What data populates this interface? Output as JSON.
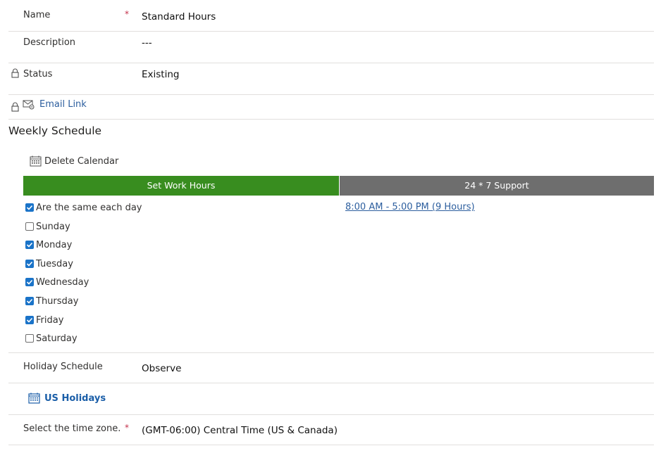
{
  "fields": {
    "name": {
      "label": "Name",
      "required_mark": "*",
      "value": "Standard Hours"
    },
    "description": {
      "label": "Description",
      "value": "---"
    },
    "status": {
      "label": "Status",
      "value": "Existing"
    },
    "email_link": {
      "label": "Email Link"
    }
  },
  "weekly_schedule": {
    "title": "Weekly Schedule",
    "delete_calendar_label": "Delete Calendar",
    "tabs": [
      {
        "label": "Set Work Hours",
        "active": true
      },
      {
        "label": "24 * 7 Support",
        "active": false
      }
    ],
    "same_each_day": {
      "label": "Are the same each day",
      "checked": true
    },
    "days": [
      {
        "label": "Sunday",
        "checked": false
      },
      {
        "label": "Monday",
        "checked": true
      },
      {
        "label": "Tuesday",
        "checked": true
      },
      {
        "label": "Wednesday",
        "checked": true
      },
      {
        "label": "Thursday",
        "checked": true
      },
      {
        "label": "Friday",
        "checked": true
      },
      {
        "label": "Saturday",
        "checked": false
      }
    ],
    "hours_link": "8:00 AM - 5:00 PM (9 Hours)"
  },
  "holiday": {
    "label": "Holiday Schedule",
    "value": "Observe",
    "calendar_link": "US Holidays"
  },
  "timezone": {
    "label": "Select the time zone.",
    "required_mark": "*",
    "value": "(GMT-06:00) Central Time (US & Canada)"
  },
  "colors": {
    "active_tab": "#388d1f",
    "inactive_tab": "#6e6e6e",
    "checkbox": "#1a73c8",
    "link": "#2c5e9e",
    "required": "#c4314b"
  }
}
